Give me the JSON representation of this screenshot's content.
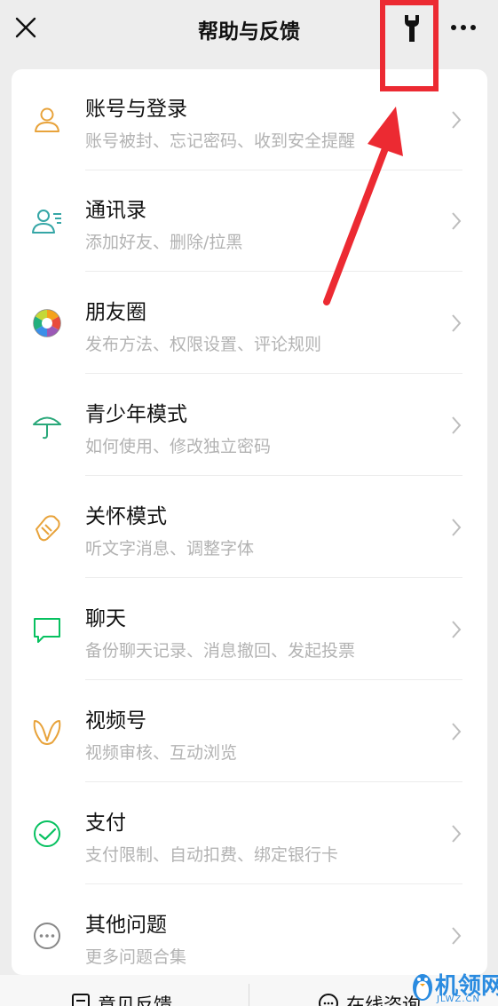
{
  "header": {
    "title": "帮助与反馈"
  },
  "items": [
    {
      "label": "账号与登录",
      "sub": "账号被封、忘记密码、收到安全提醒",
      "icon": "person-icon",
      "color": "#e8a33b"
    },
    {
      "label": "通讯录",
      "sub": "添加好友、删除/拉黑",
      "icon": "contacts-icon",
      "color": "#35a6a6"
    },
    {
      "label": "朋友圈",
      "sub": "发布方法、权限设置、评论规则",
      "icon": "moments-icon",
      "color": "#f4a21b"
    },
    {
      "label": "青少年模式",
      "sub": "如何使用、修改独立密码",
      "icon": "umbrella-icon",
      "color": "#2aa87a"
    },
    {
      "label": "关怀模式",
      "sub": "听文字消息、调整字体",
      "icon": "care-heart-icon",
      "color": "#e8a33b"
    },
    {
      "label": "聊天",
      "sub": "备份聊天记录、消息撤回、发起投票",
      "icon": "chat-bubble-icon",
      "color": "#07c160"
    },
    {
      "label": "视频号",
      "sub": "视频审核、互动浏览",
      "icon": "channels-icon",
      "color": "#e8a33b"
    },
    {
      "label": "支付",
      "sub": "支付限制、自动扣费、绑定银行卡",
      "icon": "pay-icon",
      "color": "#07c160"
    },
    {
      "label": "其他问题",
      "sub": "更多问题合集",
      "icon": "more-circle-icon",
      "color": "#888888"
    }
  ],
  "bottom": {
    "feedback_label": "意见反馈",
    "online_label": "在线咨询"
  },
  "watermark": {
    "text": "机领网",
    "url": "JLWZ.CN"
  },
  "annotation": {
    "color": "#ec2a32"
  }
}
